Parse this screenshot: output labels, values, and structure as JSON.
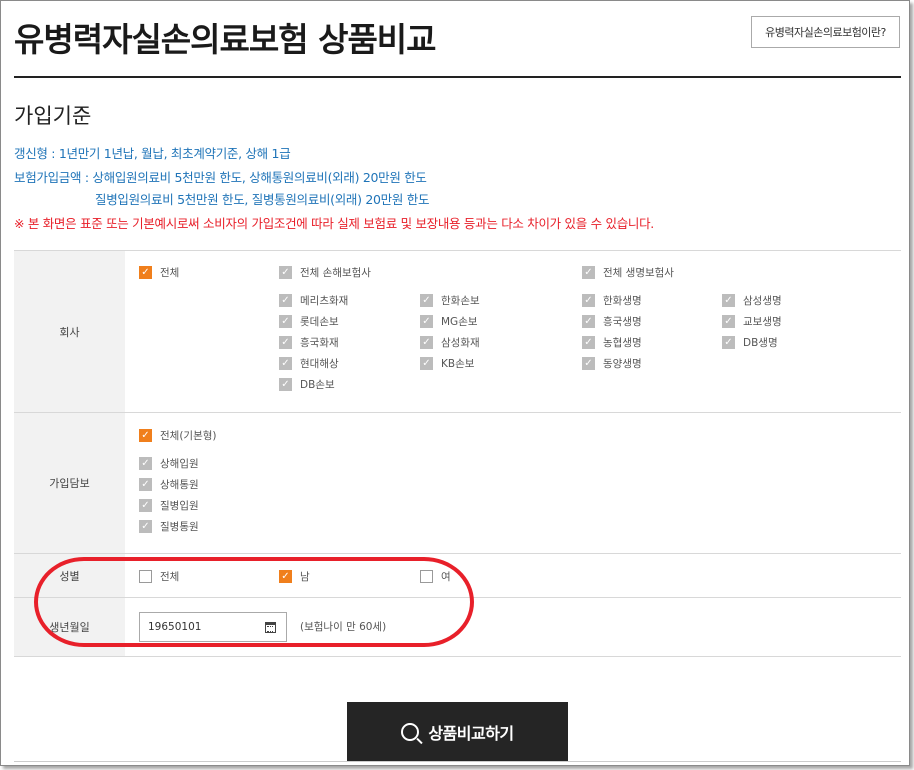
{
  "header": {
    "title": "유병력자실손의료보험 상품비교",
    "info_button": "유병력자실손의료보험이란?"
  },
  "criteria": {
    "title": "가입기준",
    "line1": "갱신형 : 1년만기 1년납, 월납, 최초계약기준, 상해 1급",
    "line2": "보험가입금액 : 상해입원의료비 5천만원 한도, 상해통원의료비(외래) 20만원 한도",
    "line3": "질병입원의료비 5천만원 한도, 질병통원의료비(외래) 20만원 한도",
    "notice": "※ 본 화면은 표준 또는 기본예시로써 소비자의 가입조건에 따라 실제 보험료 및 보장내용 등과는 다소 차이가 있을 수 있습니다."
  },
  "company": {
    "label": "회사",
    "all": "전체",
    "nonlife_all": "전체 손해보험사",
    "life_all": "전체 생명보험사",
    "nonlife": [
      "메리츠화재",
      "한화손보",
      "롯데손보",
      "MG손보",
      "흥국화재",
      "삼성화재",
      "현대해상",
      "KB손보",
      "DB손보"
    ],
    "life": [
      "한화생명",
      "삼성생명",
      "흥국생명",
      "교보생명",
      "농협생명",
      "DB생명",
      "동양생명"
    ]
  },
  "coverage": {
    "label": "가입담보",
    "all": "전체(기본형)",
    "items": [
      "상해입원",
      "상해통원",
      "질병입원",
      "질병통원"
    ]
  },
  "gender": {
    "label": "성별",
    "options": [
      "전체",
      "남",
      "여"
    ],
    "selected": "남"
  },
  "birth": {
    "label": "생년월일",
    "value": "19650101",
    "age_note": "(보험나이 만  60세)"
  },
  "action": {
    "compare": "상품비교하기"
  },
  "icons": {
    "check": "check-icon",
    "calendar": "calendar-icon",
    "search": "search-icon"
  },
  "colors": {
    "accent_orange": "#f07f1c",
    "info_blue": "#1f74b8",
    "notice_red": "#e8202a",
    "button_dark": "#252525"
  }
}
